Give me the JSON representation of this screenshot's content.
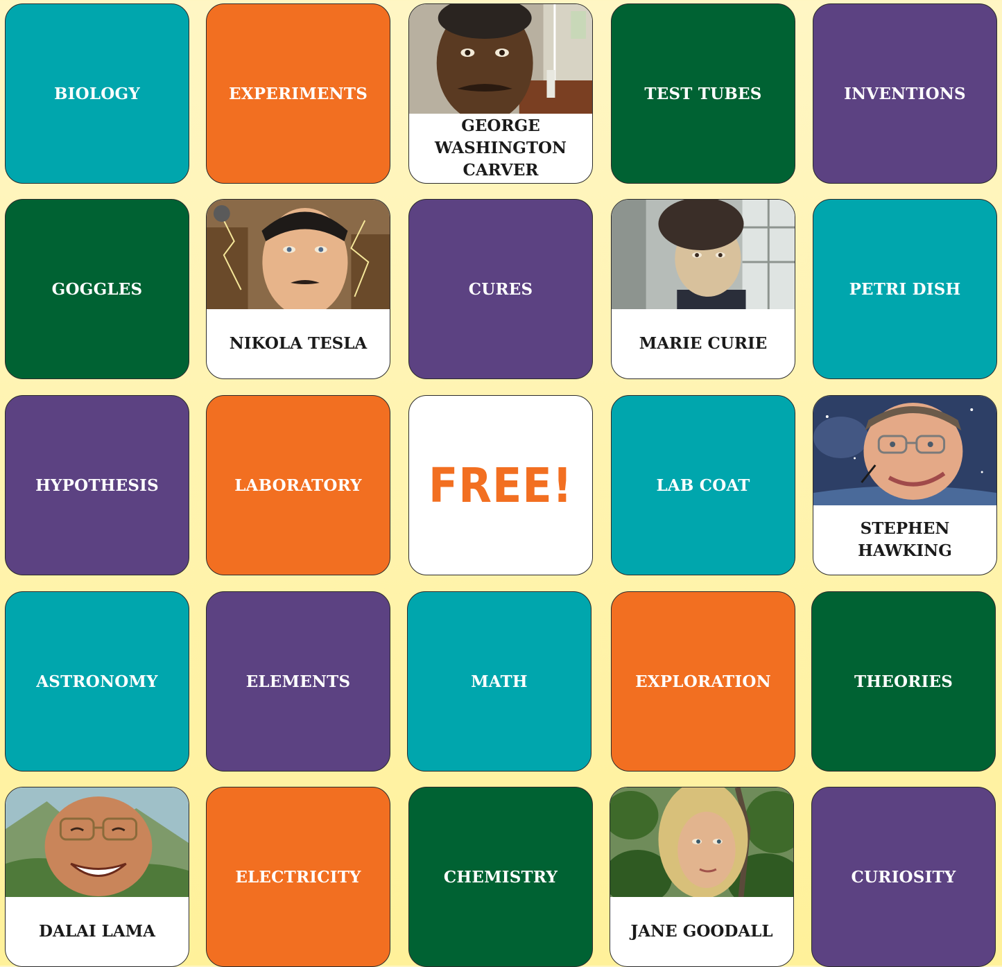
{
  "board": {
    "rows": [
      [
        {
          "type": "word",
          "label": "BIOLOGY",
          "color": "#00a6ad"
        },
        {
          "type": "word",
          "label": "EXPERIMENTS",
          "color": "#f26f21"
        },
        {
          "type": "person",
          "label": "GEORGE\nWASHINGTON\nCARVER",
          "portrait": "george-washington-carver-portrait"
        },
        {
          "type": "word",
          "label": "TEST TUBES",
          "color": "#006233"
        },
        {
          "type": "word",
          "label": "INVENTIONS",
          "color": "#5c4282"
        }
      ],
      [
        {
          "type": "word",
          "label": "GOGGLES",
          "color": "#006233"
        },
        {
          "type": "person",
          "label": "NIKOLA TESLA",
          "portrait": "nikola-tesla-portrait"
        },
        {
          "type": "word",
          "label": "CURES",
          "color": "#5c4282"
        },
        {
          "type": "person",
          "label": "MARIE CURIE",
          "portrait": "marie-curie-portrait"
        },
        {
          "type": "word",
          "label": "PETRI DISH",
          "color": "#00a6ad"
        }
      ],
      [
        {
          "type": "word",
          "label": "HYPOTHESIS",
          "color": "#5c4282"
        },
        {
          "type": "word",
          "label": "LABORATORY",
          "color": "#f26f21"
        },
        {
          "type": "free",
          "label": "FREE!",
          "color": "#f26f21"
        },
        {
          "type": "word",
          "label": "LAB COAT",
          "color": "#00a6ad"
        },
        {
          "type": "person",
          "label": "STEPHEN\nHAWKING",
          "portrait": "stephen-hawking-portrait"
        }
      ],
      [
        {
          "type": "word",
          "label": "ASTRONOMY",
          "color": "#00a6ad"
        },
        {
          "type": "word",
          "label": "ELEMENTS",
          "color": "#5c4282"
        },
        {
          "type": "word",
          "label": "MATH",
          "color": "#00a6ad"
        },
        {
          "type": "word",
          "label": "EXPLORATION",
          "color": "#f26f21"
        },
        {
          "type": "word",
          "label": "THEORIES",
          "color": "#006233"
        }
      ],
      [
        {
          "type": "person",
          "label": "DALAI LAMA",
          "portrait": "dalai-lama-portrait"
        },
        {
          "type": "word",
          "label": "ELECTRICITY",
          "color": "#f26f21"
        },
        {
          "type": "word",
          "label": "CHEMISTRY",
          "color": "#006233"
        },
        {
          "type": "person",
          "label": "JANE GOODALL",
          "portrait": "jane-goodall-portrait"
        },
        {
          "type": "word",
          "label": "CURIOSITY",
          "color": "#5c4282"
        }
      ]
    ]
  }
}
